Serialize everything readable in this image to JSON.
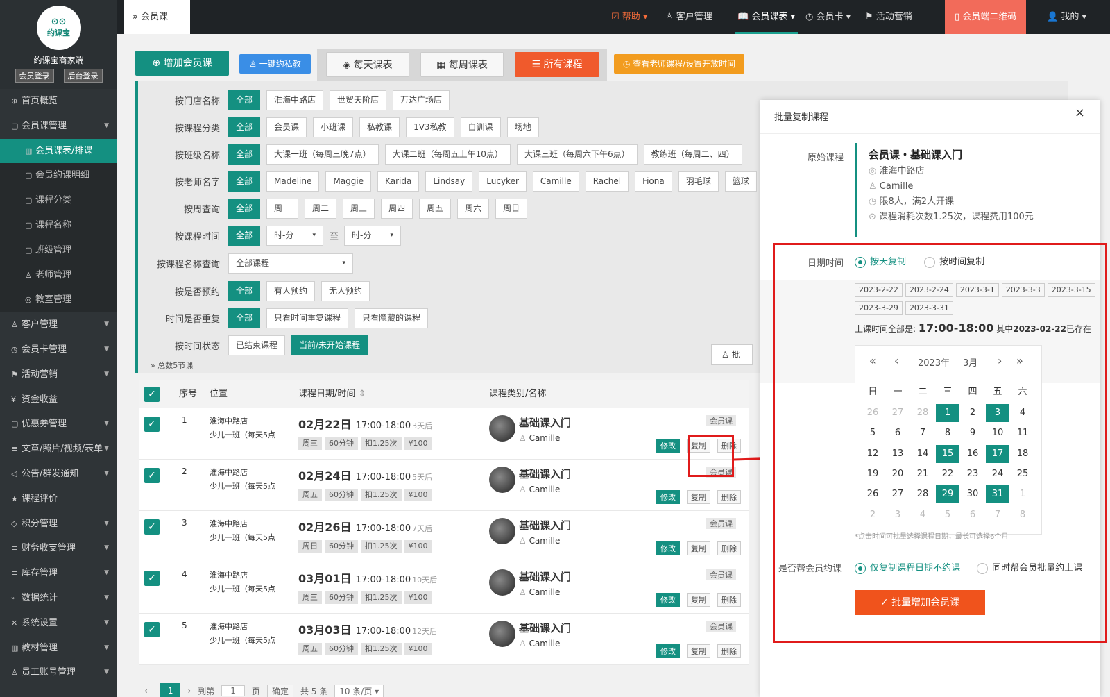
{
  "sidebar": {
    "brand": "约课宝",
    "shop": "约课宝商家端",
    "btn_member": "会员登录",
    "btn_admin": "后台登录",
    "items": [
      {
        "label": "首页概览",
        "icon": "globe-icon",
        "type": "top"
      },
      {
        "label": "会员课管理",
        "icon": "doc-icon",
        "type": "top",
        "caret": true
      },
      {
        "label": "会员课表/排课",
        "icon": "book-icon",
        "type": "sub",
        "active": true
      },
      {
        "label": "会员约课明细",
        "icon": "doc-icon",
        "type": "sub"
      },
      {
        "label": "课程分类",
        "icon": "doc-icon",
        "type": "sub"
      },
      {
        "label": "课程名称",
        "icon": "doc-icon",
        "type": "sub"
      },
      {
        "label": "班级管理",
        "icon": "doc-icon",
        "type": "sub"
      },
      {
        "label": "老师管理",
        "icon": "user-icon",
        "type": "sub"
      },
      {
        "label": "教室管理",
        "icon": "pin-icon",
        "type": "sub"
      },
      {
        "label": "客户管理",
        "icon": "user-icon",
        "type": "top",
        "caret": true
      },
      {
        "label": "会员卡管理",
        "icon": "clock-icon",
        "type": "top",
        "caret": true
      },
      {
        "label": "活动营销",
        "icon": "flag-icon",
        "type": "top",
        "caret": true
      },
      {
        "label": "资金收益",
        "icon": "money-icon",
        "type": "top"
      },
      {
        "label": "优惠券管理",
        "icon": "doc-icon",
        "type": "top",
        "caret": true
      },
      {
        "label": "文章/照片/视频/表单",
        "icon": "list-icon",
        "type": "top",
        "caret": true
      },
      {
        "label": "公告/群发通知",
        "icon": "speaker-icon",
        "type": "top",
        "caret": true
      },
      {
        "label": "课程评价",
        "icon": "star-icon",
        "type": "top"
      },
      {
        "label": "积分管理",
        "icon": "diamond-icon",
        "type": "top",
        "caret": true
      },
      {
        "label": "财务收支管理",
        "icon": "list-icon",
        "type": "top",
        "caret": true
      },
      {
        "label": "库存管理",
        "icon": "list-icon",
        "type": "top",
        "caret": true
      },
      {
        "label": "数据统计",
        "icon": "chart-icon",
        "type": "top",
        "caret": true
      },
      {
        "label": "系统设置",
        "icon": "tools-icon",
        "type": "top",
        "caret": true
      },
      {
        "label": "教材管理",
        "icon": "book-icon",
        "type": "top",
        "caret": true
      },
      {
        "label": "员工账号管理",
        "icon": "user-icon",
        "type": "top",
        "caret": true
      }
    ]
  },
  "topbar": {
    "breadcrumb": "会员课",
    "help": "帮助",
    "customer": "客户管理",
    "schedule": "会员课表",
    "card": "会员卡",
    "activity": "活动营销",
    "qrcode": "会员端二维码",
    "me": "我的"
  },
  "toolbar": {
    "add": "增加会员课",
    "private": "一键约私教",
    "daily": "每天课表",
    "weekly": "每周课表",
    "all": "所有课程",
    "teacher": "查看老师课程/设置开放时间"
  },
  "filters": [
    {
      "label": "按门店名称",
      "chips": [
        "全部",
        "淮海中路店",
        "世贸天阶店",
        "万达广场店"
      ]
    },
    {
      "label": "按课程分类",
      "chips": [
        "全部",
        "会员课",
        "小班课",
        "私教课",
        "1V3私教",
        "自训课",
        "场地"
      ]
    },
    {
      "label": "按班级名称",
      "chips": [
        "全部",
        "大课一班（每周三晚7点）",
        "大课二班（每周五上午10点）",
        "大课三班（每周六下午6点）",
        "教练班（每周二、四）"
      ]
    },
    {
      "label": "按老师名字",
      "chips": [
        "全部",
        "Madeline",
        "Maggie",
        "Karida",
        "Lindsay",
        "Lucyker",
        "Camille",
        "Rachel",
        "Fiona",
        "羽毛球",
        "篮球"
      ]
    },
    {
      "label": "按周查询",
      "chips": [
        "全部",
        "周一",
        "周二",
        "周三",
        "周四",
        "周五",
        "周六",
        "周日"
      ]
    }
  ],
  "time_filter": {
    "label": "按课程时间",
    "all": "全部",
    "from": "时-分",
    "to_label": "至",
    "to": "时-分"
  },
  "name_filter": {
    "label": "按课程名称查询",
    "value": "全部课程"
  },
  "booking_filter": {
    "label": "按是否预约",
    "chips": [
      "全部",
      "有人预约",
      "无人预约"
    ]
  },
  "repeat_filter": {
    "label": "时间是否重复",
    "chips": [
      "全部",
      "只看时间重复课程",
      "只看隐藏的课程"
    ]
  },
  "status_filter": {
    "label": "按时间状态",
    "chips": [
      "已结束课程",
      "当前/未开始课程"
    ]
  },
  "total": "总数5节课",
  "batch_btn": "批",
  "table": {
    "headers": {
      "seq": "序号",
      "location": "位置",
      "datetime": "课程日期/时间",
      "category": "课程类别/名称"
    },
    "rows": [
      {
        "seq": "1",
        "store": "淮海中路店",
        "class": "少儿一班（每天5点",
        "date": "02月22日",
        "time": "17:00-18:00",
        "rel": "3天后",
        "weekday": "周三",
        "dur": "60分钟",
        "deduct": "扣1.25次",
        "price": "¥100",
        "name": "基础课入门",
        "teacher": "Camille",
        "type": "会员课"
      },
      {
        "seq": "2",
        "store": "淮海中路店",
        "class": "少儿一班（每天5点",
        "date": "02月24日",
        "time": "17:00-18:00",
        "rel": "5天后",
        "weekday": "周五",
        "dur": "60分钟",
        "deduct": "扣1.25次",
        "price": "¥100",
        "name": "基础课入门",
        "teacher": "Camille",
        "type": "会员课"
      },
      {
        "seq": "3",
        "store": "淮海中路店",
        "class": "少儿一班（每天5点",
        "date": "02月26日",
        "time": "17:00-18:00",
        "rel": "7天后",
        "weekday": "周日",
        "dur": "60分钟",
        "deduct": "扣1.25次",
        "price": "¥100",
        "name": "基础课入门",
        "teacher": "Camille",
        "type": "会员课"
      },
      {
        "seq": "4",
        "store": "淮海中路店",
        "class": "少儿一班（每天5点",
        "date": "03月01日",
        "time": "17:00-18:00",
        "rel": "10天后",
        "weekday": "周三",
        "dur": "60分钟",
        "deduct": "扣1.25次",
        "price": "¥100",
        "name": "基础课入门",
        "teacher": "Camille",
        "type": "会员课"
      },
      {
        "seq": "5",
        "store": "淮海中路店",
        "class": "少儿一班（每天5点",
        "date": "03月03日",
        "time": "17:00-18:00",
        "rel": "12天后",
        "weekday": "周五",
        "dur": "60分钟",
        "deduct": "扣1.25次",
        "price": "¥100",
        "name": "基础课入门",
        "teacher": "Camille",
        "type": "会员课"
      }
    ],
    "ops": {
      "edit": "修改",
      "copy": "复制",
      "delete": "删除"
    }
  },
  "pager": {
    "page": "1",
    "goto": "到第",
    "goto_val": "1",
    "page_unit": "页",
    "confirm": "确定",
    "total": "共 5 条",
    "size": "10 条/页"
  },
  "modal": {
    "title": "批量复制课程",
    "close": "×",
    "orig_label": "原始课程",
    "orig_name": "会员课・基础课入门",
    "orig_store": "淮海中路店",
    "orig_teacher": "Camille",
    "orig_limit": "限8人，满2人开课",
    "orig_fee": "课程消耗次数1.25次，课程费用100元",
    "dt_label": "日期时间",
    "opt_day": "按天复制",
    "opt_time": "按时间复制",
    "dates": [
      "2023-2-22",
      "2023-2-24",
      "2023-3-1",
      "2023-3-3",
      "2023-3-15",
      "2023-3-29",
      "2023-3-31"
    ],
    "time_prefix": "上课时间全部是:",
    "time_value": "17:00-18:00",
    "exist_prefix": "其中",
    "exist_date": "2023-02-22",
    "exist_suffix": "已存在",
    "cal_year": "2023年",
    "cal_month": "3月",
    "weekdays": [
      "日",
      "一",
      "二",
      "三",
      "四",
      "五",
      "六"
    ],
    "days": [
      [
        "26",
        "27",
        "28",
        "1",
        "2",
        "3",
        "4"
      ],
      [
        "5",
        "6",
        "7",
        "8",
        "9",
        "10",
        "11"
      ],
      [
        "12",
        "13",
        "14",
        "15",
        "16",
        "17",
        "18"
      ],
      [
        "19",
        "20",
        "21",
        "22",
        "23",
        "24",
        "25"
      ],
      [
        "26",
        "27",
        "28",
        "29",
        "30",
        "31",
        "1"
      ],
      [
        "2",
        "3",
        "4",
        "5",
        "6",
        "7",
        "8"
      ]
    ],
    "selected": [
      "1",
      "3",
      "15",
      "17",
      "29",
      "31"
    ],
    "hint": "*点击时间可批量选择课程日期，最长可选择6个月",
    "book_label": "是否帮会员约课",
    "book_opt1": "仅复制课程日期不约课",
    "book_opt2": "同时帮会员批量约上课",
    "submit": "批量增加会员课"
  },
  "colors": {
    "accent": "#149081",
    "orange": "#f0531c",
    "red": "#e01b1b"
  }
}
